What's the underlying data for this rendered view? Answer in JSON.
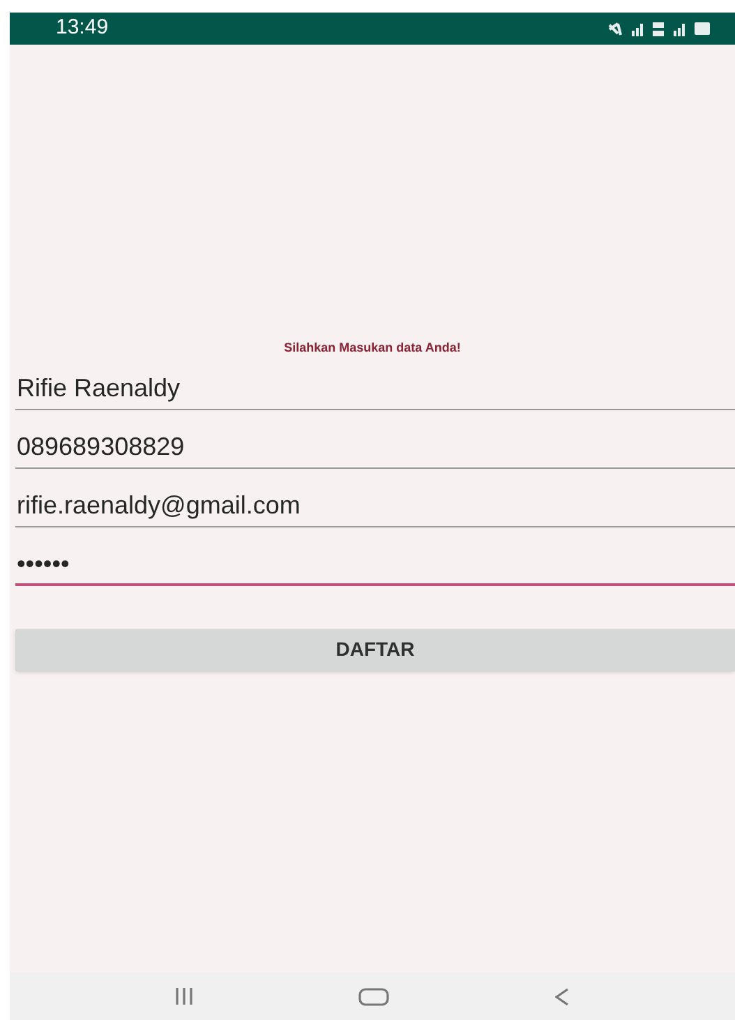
{
  "status_bar": {
    "time": "13:49"
  },
  "heading": "Silahkan Masukan data Anda!",
  "fields": [
    {
      "value": "Rifie Raenaldy",
      "focused": false
    },
    {
      "value": "089689308829",
      "focused": false
    },
    {
      "value": "rifie.raenaldy@gmail.com",
      "focused": false
    },
    {
      "value": "••••••",
      "focused": true
    }
  ],
  "button": "DAFTAR"
}
